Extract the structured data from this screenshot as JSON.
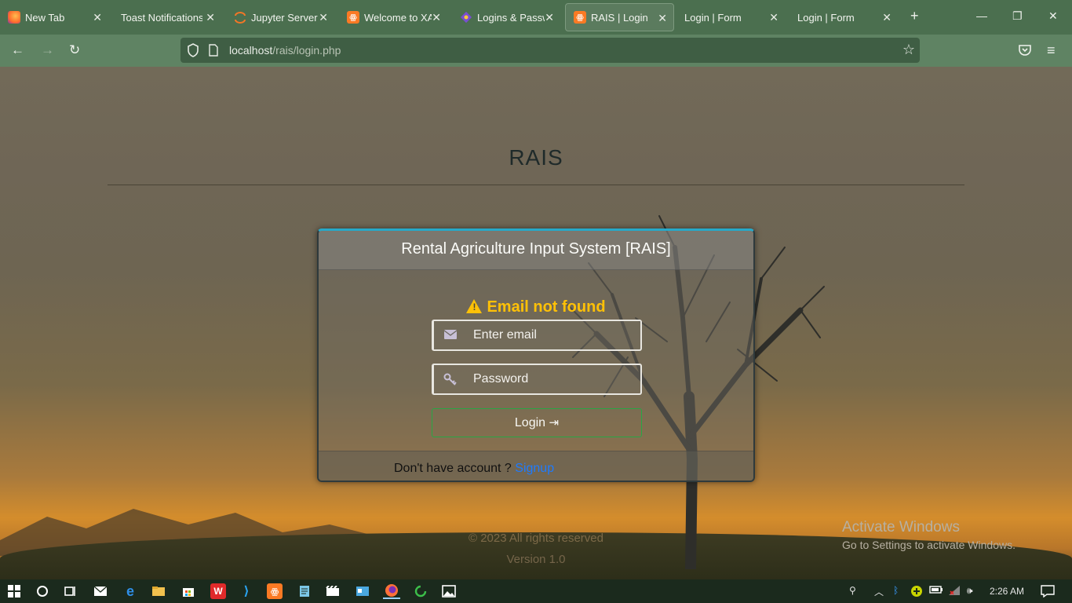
{
  "tabs": [
    {
      "title": "New Tab"
    },
    {
      "title": "Toast Notifications V"
    },
    {
      "title": "Jupyter Server"
    },
    {
      "title": "Welcome to XAI"
    },
    {
      "title": "Logins & Passwo"
    },
    {
      "title": "RAIS | Login"
    },
    {
      "title": "Login | Form"
    },
    {
      "title": "Login | Form"
    }
  ],
  "address": {
    "host": "localhost",
    "path": "/rais/login.php"
  },
  "page": {
    "brand": "RAIS",
    "card_title": "Rental Agriculture Input System [RAIS]",
    "alert": "Email not found",
    "email_placeholder": "Enter email",
    "password_placeholder": "Password",
    "login_label": "Login",
    "footer_text": "Don't have account ?",
    "signup_link": "Signup",
    "copyright": "© 2023 All rights reserved",
    "version": "Version 1.0"
  },
  "watermark": {
    "line1": "Activate Windows",
    "line2": "Go to Settings to activate Windows."
  },
  "clock": "2:26 AM",
  "colors": {
    "accent_border": "#26a9c9",
    "alert": "#ffc107",
    "login_border": "#28a745",
    "link": "#1e7bff"
  }
}
